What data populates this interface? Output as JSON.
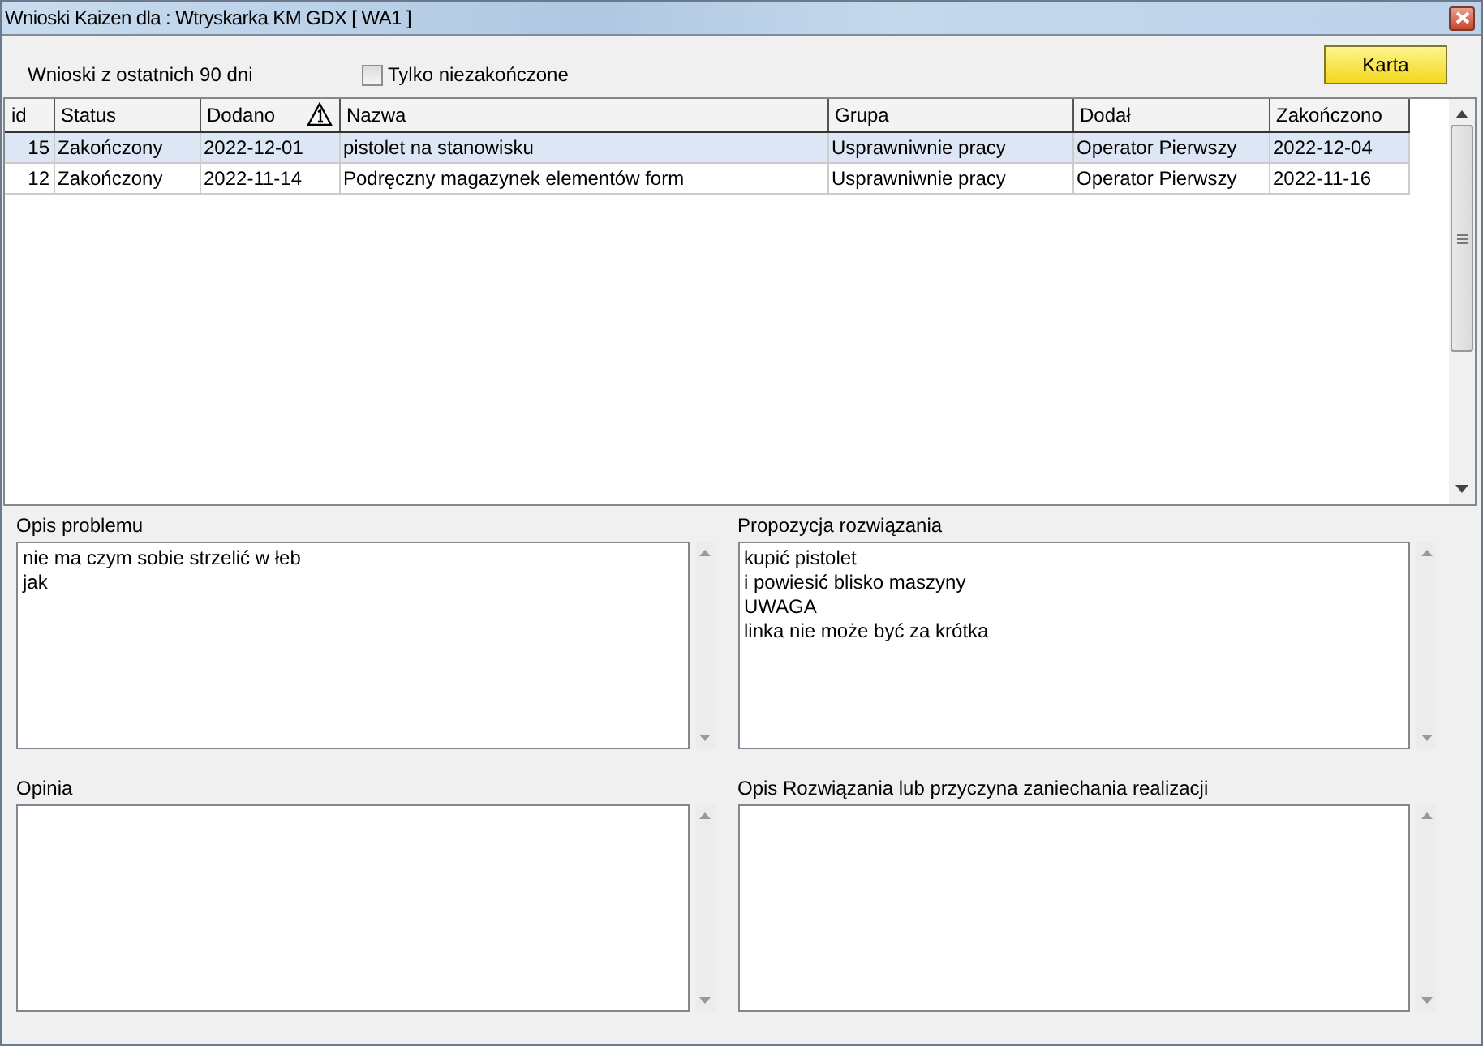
{
  "window": {
    "title": "Wnioski Kaizen dla : Wtryskarka KM GDX [ WA1 ]"
  },
  "filter": {
    "label": "Wnioski z ostatnich 90 dni",
    "checkbox": {
      "label": "Tylko niezakończone",
      "checked": false
    }
  },
  "buttons": [
    {
      "label": "Karta"
    }
  ],
  "table": {
    "columns": [
      {
        "label": "id"
      },
      {
        "label": "Status"
      },
      {
        "label": "Dodano",
        "warning_icon": true
      },
      {
        "label": "Nazwa"
      },
      {
        "label": "Grupa"
      },
      {
        "label": "Dodał"
      },
      {
        "label": "Zakończono"
      }
    ],
    "rows": [
      {
        "selected": true,
        "cells": [
          "15",
          "Zakończony",
          "2022-12-01",
          "pistolet na stanowisku",
          "Usprawniwnie pracy",
          "Operator Pierwszy",
          "2022-12-04"
        ]
      },
      {
        "selected": false,
        "cells": [
          "12",
          "Zakończony",
          "2022-11-14",
          "Podręczny magazynek elementów form",
          "Usprawniwnie pracy",
          "Operator Pierwszy",
          "2022-11-16"
        ]
      }
    ]
  },
  "panels": [
    {
      "label": "Opis problemu",
      "lines": [
        "nie ma czym sobie strzelić w łeb",
        "jak"
      ]
    },
    {
      "label": "Propozycja rozwiązania",
      "lines": [
        "kupić pistolet",
        "i powiesić blisko maszyny",
        "UWAGA",
        "linka nie może być za krótka"
      ]
    },
    {
      "label": "Opinia"
    },
    {
      "label": "Opis Rozwiązania lub przyczyna zaniechania realizacji"
    }
  ]
}
